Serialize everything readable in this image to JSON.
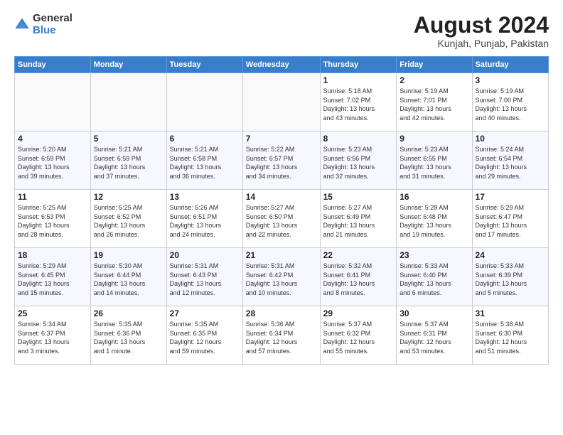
{
  "logo": {
    "general": "General",
    "blue": "Blue"
  },
  "title": "August 2024",
  "subtitle": "Kunjah, Punjab, Pakistan",
  "weekdays": [
    "Sunday",
    "Monday",
    "Tuesday",
    "Wednesday",
    "Thursday",
    "Friday",
    "Saturday"
  ],
  "weeks": [
    [
      {
        "day": "",
        "info": ""
      },
      {
        "day": "",
        "info": ""
      },
      {
        "day": "",
        "info": ""
      },
      {
        "day": "",
        "info": ""
      },
      {
        "day": "1",
        "info": "Sunrise: 5:18 AM\nSunset: 7:02 PM\nDaylight: 13 hours\nand 43 minutes."
      },
      {
        "day": "2",
        "info": "Sunrise: 5:19 AM\nSunset: 7:01 PM\nDaylight: 13 hours\nand 42 minutes."
      },
      {
        "day": "3",
        "info": "Sunrise: 5:19 AM\nSunset: 7:00 PM\nDaylight: 13 hours\nand 40 minutes."
      }
    ],
    [
      {
        "day": "4",
        "info": "Sunrise: 5:20 AM\nSunset: 6:59 PM\nDaylight: 13 hours\nand 39 minutes."
      },
      {
        "day": "5",
        "info": "Sunrise: 5:21 AM\nSunset: 6:59 PM\nDaylight: 13 hours\nand 37 minutes."
      },
      {
        "day": "6",
        "info": "Sunrise: 5:21 AM\nSunset: 6:58 PM\nDaylight: 13 hours\nand 36 minutes."
      },
      {
        "day": "7",
        "info": "Sunrise: 5:22 AM\nSunset: 6:57 PM\nDaylight: 13 hours\nand 34 minutes."
      },
      {
        "day": "8",
        "info": "Sunrise: 5:23 AM\nSunset: 6:56 PM\nDaylight: 13 hours\nand 32 minutes."
      },
      {
        "day": "9",
        "info": "Sunrise: 5:23 AM\nSunset: 6:55 PM\nDaylight: 13 hours\nand 31 minutes."
      },
      {
        "day": "10",
        "info": "Sunrise: 5:24 AM\nSunset: 6:54 PM\nDaylight: 13 hours\nand 29 minutes."
      }
    ],
    [
      {
        "day": "11",
        "info": "Sunrise: 5:25 AM\nSunset: 6:53 PM\nDaylight: 13 hours\nand 28 minutes."
      },
      {
        "day": "12",
        "info": "Sunrise: 5:25 AM\nSunset: 6:52 PM\nDaylight: 13 hours\nand 26 minutes."
      },
      {
        "day": "13",
        "info": "Sunrise: 5:26 AM\nSunset: 6:51 PM\nDaylight: 13 hours\nand 24 minutes."
      },
      {
        "day": "14",
        "info": "Sunrise: 5:27 AM\nSunset: 6:50 PM\nDaylight: 13 hours\nand 22 minutes."
      },
      {
        "day": "15",
        "info": "Sunrise: 5:27 AM\nSunset: 6:49 PM\nDaylight: 13 hours\nand 21 minutes."
      },
      {
        "day": "16",
        "info": "Sunrise: 5:28 AM\nSunset: 6:48 PM\nDaylight: 13 hours\nand 19 minutes."
      },
      {
        "day": "17",
        "info": "Sunrise: 5:29 AM\nSunset: 6:47 PM\nDaylight: 13 hours\nand 17 minutes."
      }
    ],
    [
      {
        "day": "18",
        "info": "Sunrise: 5:29 AM\nSunset: 6:45 PM\nDaylight: 13 hours\nand 15 minutes."
      },
      {
        "day": "19",
        "info": "Sunrise: 5:30 AM\nSunset: 6:44 PM\nDaylight: 13 hours\nand 14 minutes."
      },
      {
        "day": "20",
        "info": "Sunrise: 5:31 AM\nSunset: 6:43 PM\nDaylight: 13 hours\nand 12 minutes."
      },
      {
        "day": "21",
        "info": "Sunrise: 5:31 AM\nSunset: 6:42 PM\nDaylight: 13 hours\nand 10 minutes."
      },
      {
        "day": "22",
        "info": "Sunrise: 5:32 AM\nSunset: 6:41 PM\nDaylight: 13 hours\nand 8 minutes."
      },
      {
        "day": "23",
        "info": "Sunrise: 5:33 AM\nSunset: 6:40 PM\nDaylight: 13 hours\nand 6 minutes."
      },
      {
        "day": "24",
        "info": "Sunrise: 5:33 AM\nSunset: 6:39 PM\nDaylight: 13 hours\nand 5 minutes."
      }
    ],
    [
      {
        "day": "25",
        "info": "Sunrise: 5:34 AM\nSunset: 6:37 PM\nDaylight: 13 hours\nand 3 minutes."
      },
      {
        "day": "26",
        "info": "Sunrise: 5:35 AM\nSunset: 6:36 PM\nDaylight: 13 hours\nand 1 minute."
      },
      {
        "day": "27",
        "info": "Sunrise: 5:35 AM\nSunset: 6:35 PM\nDaylight: 12 hours\nand 59 minutes."
      },
      {
        "day": "28",
        "info": "Sunrise: 5:36 AM\nSunset: 6:34 PM\nDaylight: 12 hours\nand 57 minutes."
      },
      {
        "day": "29",
        "info": "Sunrise: 5:37 AM\nSunset: 6:32 PM\nDaylight: 12 hours\nand 55 minutes."
      },
      {
        "day": "30",
        "info": "Sunrise: 5:37 AM\nSunset: 6:31 PM\nDaylight: 12 hours\nand 53 minutes."
      },
      {
        "day": "31",
        "info": "Sunrise: 5:38 AM\nSunset: 6:30 PM\nDaylight: 12 hours\nand 51 minutes."
      }
    ]
  ]
}
